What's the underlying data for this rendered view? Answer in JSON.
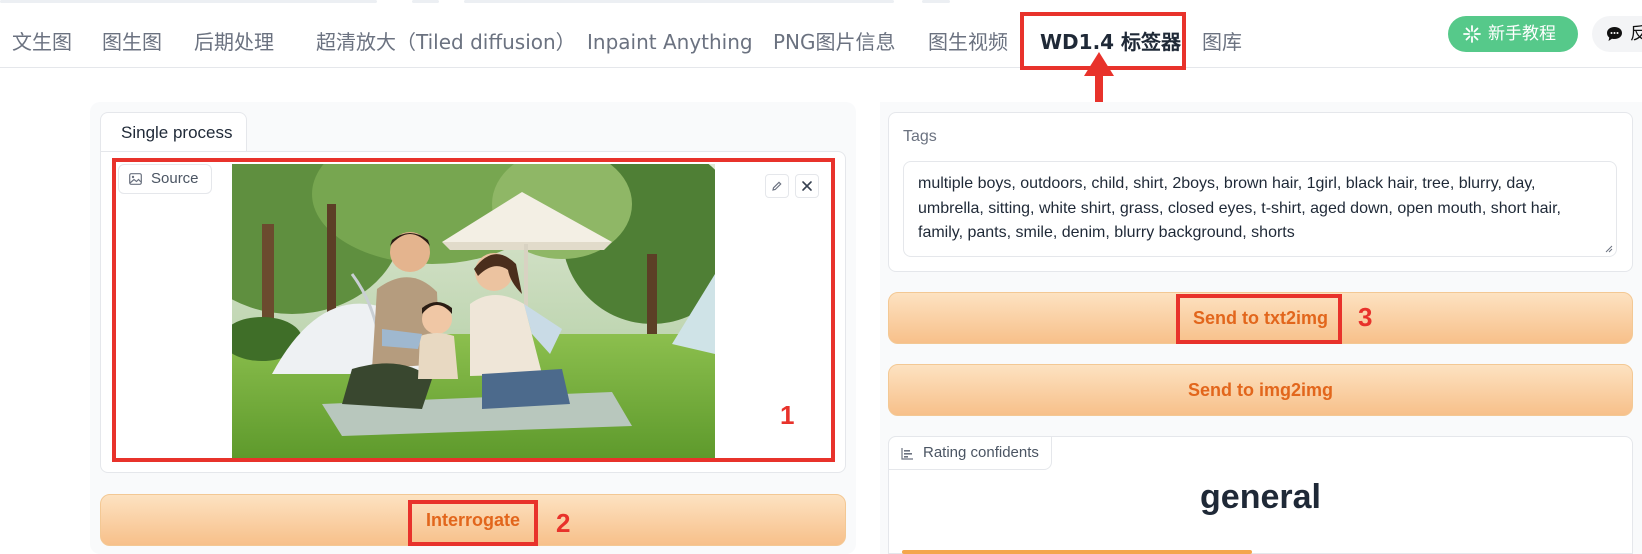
{
  "tabs": [
    {
      "label": "文生图"
    },
    {
      "label": "图生图"
    },
    {
      "label": "后期处理"
    },
    {
      "label": "超清放大（Tiled diffusion）"
    },
    {
      "label": "Inpaint Anything"
    },
    {
      "label": "PNG图片信息"
    },
    {
      "label": "图生视频"
    },
    {
      "label": "WD1.4 标签器",
      "active": true
    },
    {
      "label": "图库"
    }
  ],
  "header_buttons": {
    "tutorial": "新手教程",
    "feedback": "反馈"
  },
  "left": {
    "subtab": "Single process",
    "source_label": "Source",
    "interrogate_label": "Interrogate"
  },
  "right": {
    "tags_label": "Tags",
    "tags_value": "multiple boys, outdoors, child, shirt, 2boys, brown hair, 1girl, black hair, tree, blurry, day, umbrella, sitting, white shirt, grass, closed eyes, t-shirt, aged down, open mouth, short hair, family, pants, smile, denim, blurry background, shorts",
    "send_txt2img": "Send to txt2img",
    "send_img2img": "Send to img2img",
    "rating_label": "Rating confidents",
    "rating_top": "general",
    "rating_top_confidence": 0.47
  },
  "annotations": {
    "n1": "1",
    "n2": "2",
    "n3": "3"
  },
  "colors": {
    "annotation_red": "#e8322b",
    "accent_orange": "#e2661c",
    "tutorial_green": "#56c98a"
  }
}
